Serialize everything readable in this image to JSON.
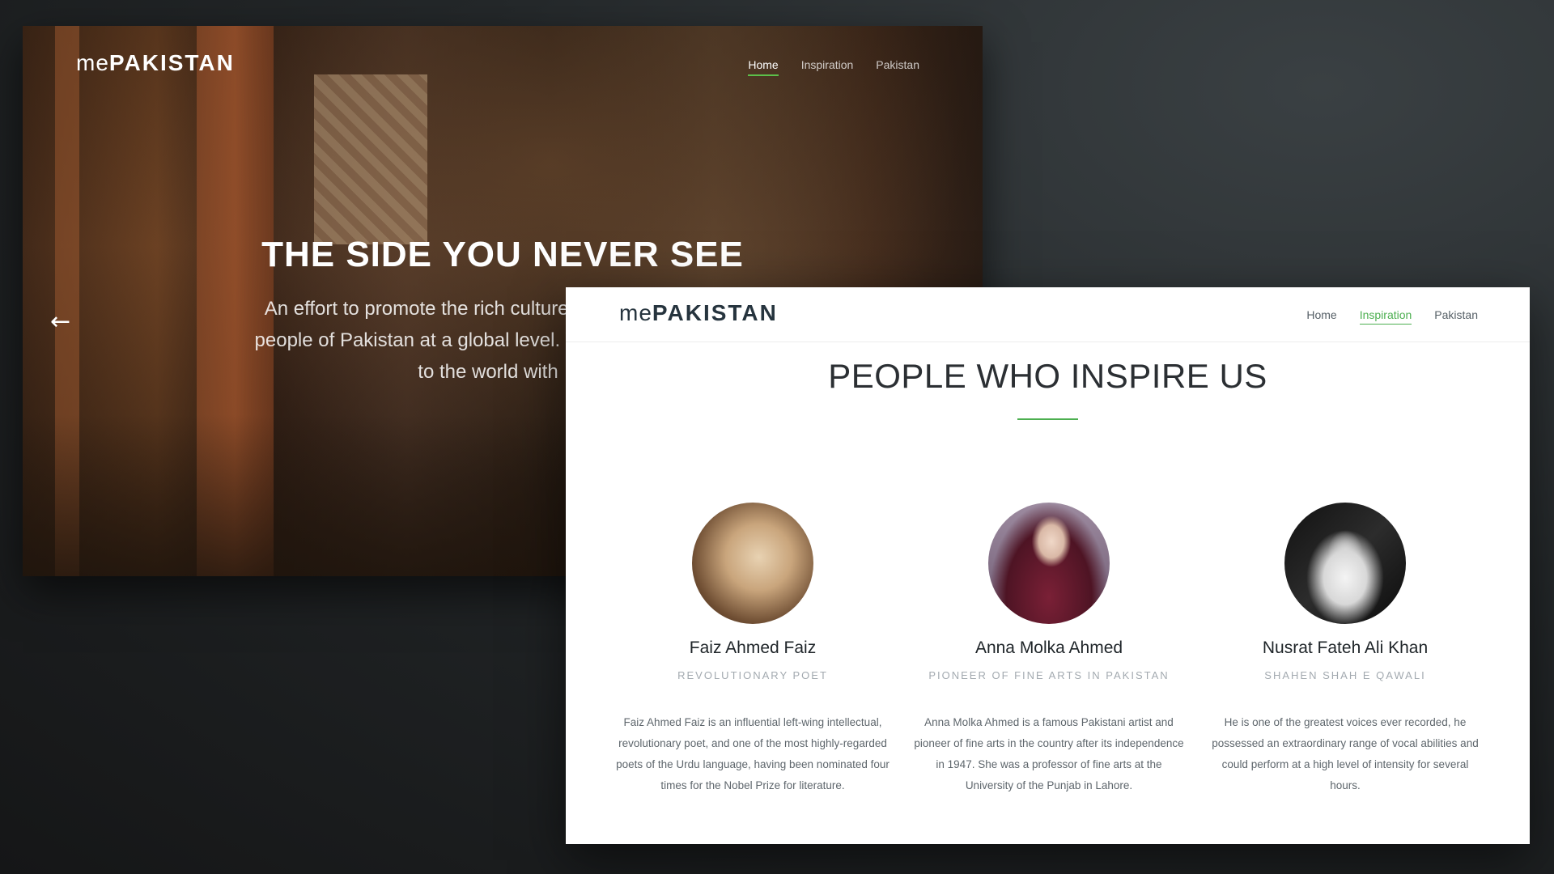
{
  "hero": {
    "logo_light": "me",
    "logo_bold": "PAKISTAN",
    "nav": [
      "Home",
      "Inspiration",
      "Pakistan"
    ],
    "title": "THE SIDE YOU NEVER SEE",
    "subtitle_lines": [
      "An effort to promote the rich culture,",
      "people of Pakistan at a global level. W",
      "to the world with"
    ],
    "prev_arrow": "←"
  },
  "inspiration": {
    "logo_light": "me",
    "logo_bold": "PAKISTAN",
    "nav": [
      "Home",
      "Inspiration",
      "Pakistan"
    ],
    "heading": "PEOPLE WHO INSPIRE US",
    "people": [
      {
        "name": "Faiz Ahmed Faiz",
        "role": "Revolutionary Poet",
        "bio": "Faiz Ahmed Faiz is an influential left-wing intellectual, revolutionary poet, and one of the most highly-regarded poets of the Urdu language, having been nominated four times for the Nobel Prize for literature."
      },
      {
        "name": "Anna Molka Ahmed",
        "role": "Pioneer of Fine Arts in Pakistan",
        "bio": "Anna Molka Ahmed is a famous Pakistani artist and pioneer of fine arts in the country after its independence in 1947. She was a professor of fine arts at the University of the Punjab in Lahore."
      },
      {
        "name": "Nusrat Fateh Ali Khan",
        "role": "Shahen Shah E Qawali",
        "bio": "He is one of the greatest voices ever recorded, he possessed an extraordinary range of vocal abilities and could perform at a high level of intensity for several hours."
      }
    ]
  },
  "colors": {
    "accent": "#4caf50",
    "logo_dark": "#26343e"
  }
}
